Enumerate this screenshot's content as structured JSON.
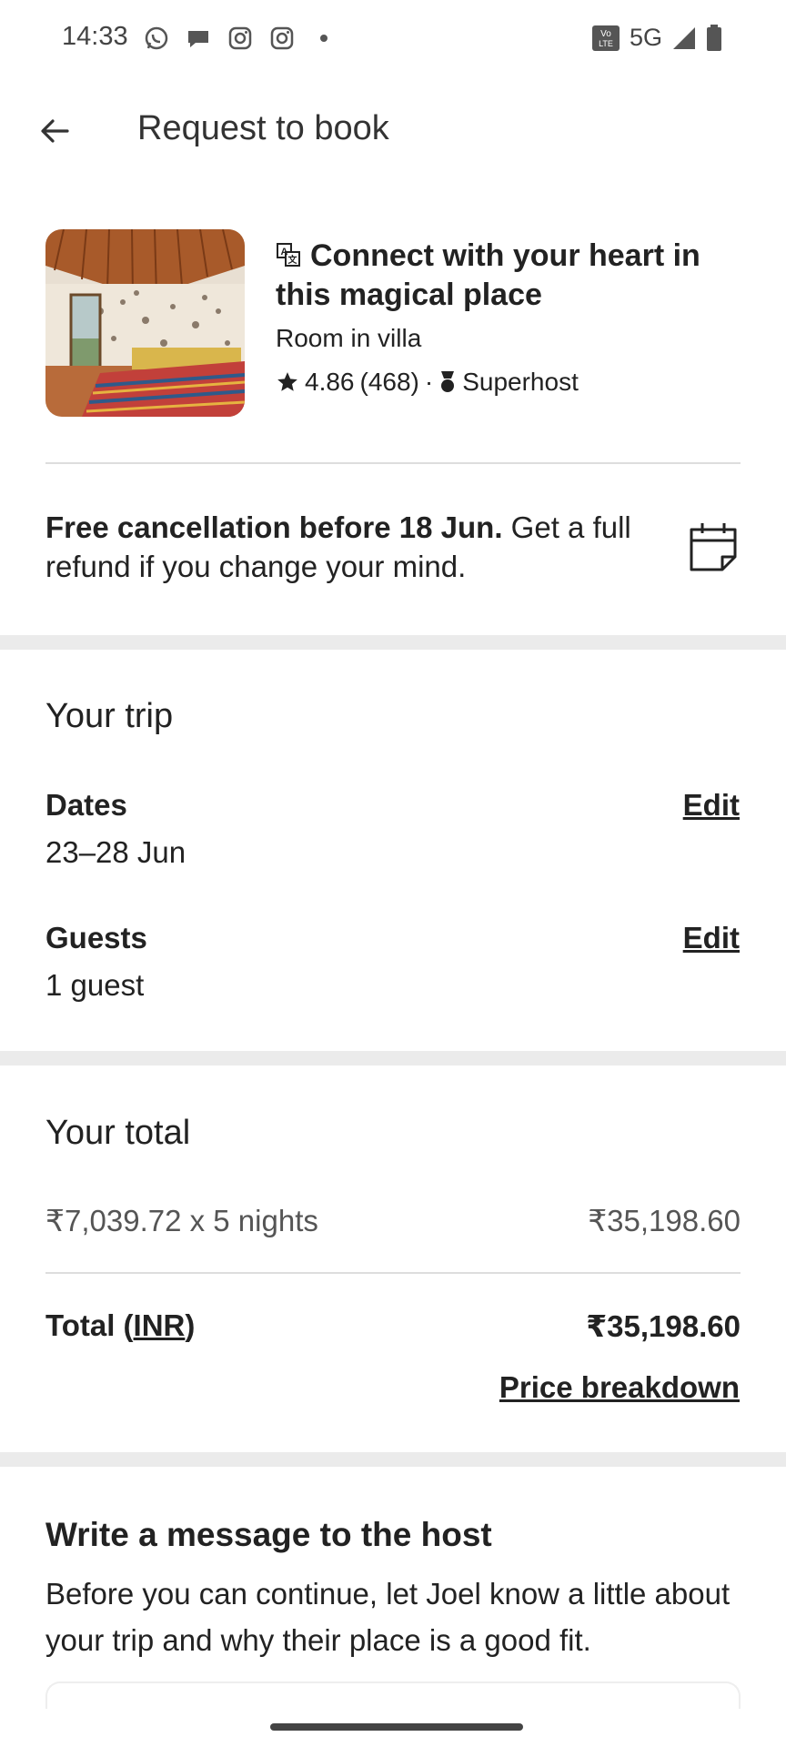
{
  "status_bar": {
    "time": "14:33",
    "network": "5G",
    "left_icons": [
      "whatsapp-icon",
      "chat-icon",
      "instagram-icon",
      "instagram-icon",
      "dot-icon"
    ],
    "right_icons": [
      "volte-icon",
      "signal-icon",
      "battery-icon"
    ]
  },
  "app_bar": {
    "title": "Request to book",
    "back_icon": "arrow-left-icon"
  },
  "listing": {
    "title": "Connect with your heart in this magical place",
    "type": "Room in villa",
    "rating": "4.86",
    "reviews": "(468)",
    "separator": "·",
    "badge": "Superhost"
  },
  "cancellation": {
    "bold_text": "Free cancellation before 18 Jun.",
    "text": " Get a full refund if you change your mind."
  },
  "trip": {
    "title": "Your trip",
    "dates_label": "Dates",
    "dates_value": "23–28 Jun",
    "guests_label": "Guests",
    "guests_value": "1 guest",
    "edit_label": "Edit"
  },
  "total": {
    "title": "Your total",
    "line_desc": "₹7,039.72 x 5 nights",
    "line_amount": "₹35,198.60",
    "total_label_prefix": "Total (",
    "currency": "INR",
    "total_label_suffix": ")",
    "total_amount": "₹35,198.60",
    "breakdown_link": "Price breakdown"
  },
  "message": {
    "title": "Write a message to the host",
    "description": "Before you can continue, let Joel know a little about your trip and why their place is a good fit."
  },
  "colors": {
    "text": "#222222",
    "muted": "#555555",
    "divider": "#dddddd",
    "section_gap": "#ebebeb"
  }
}
